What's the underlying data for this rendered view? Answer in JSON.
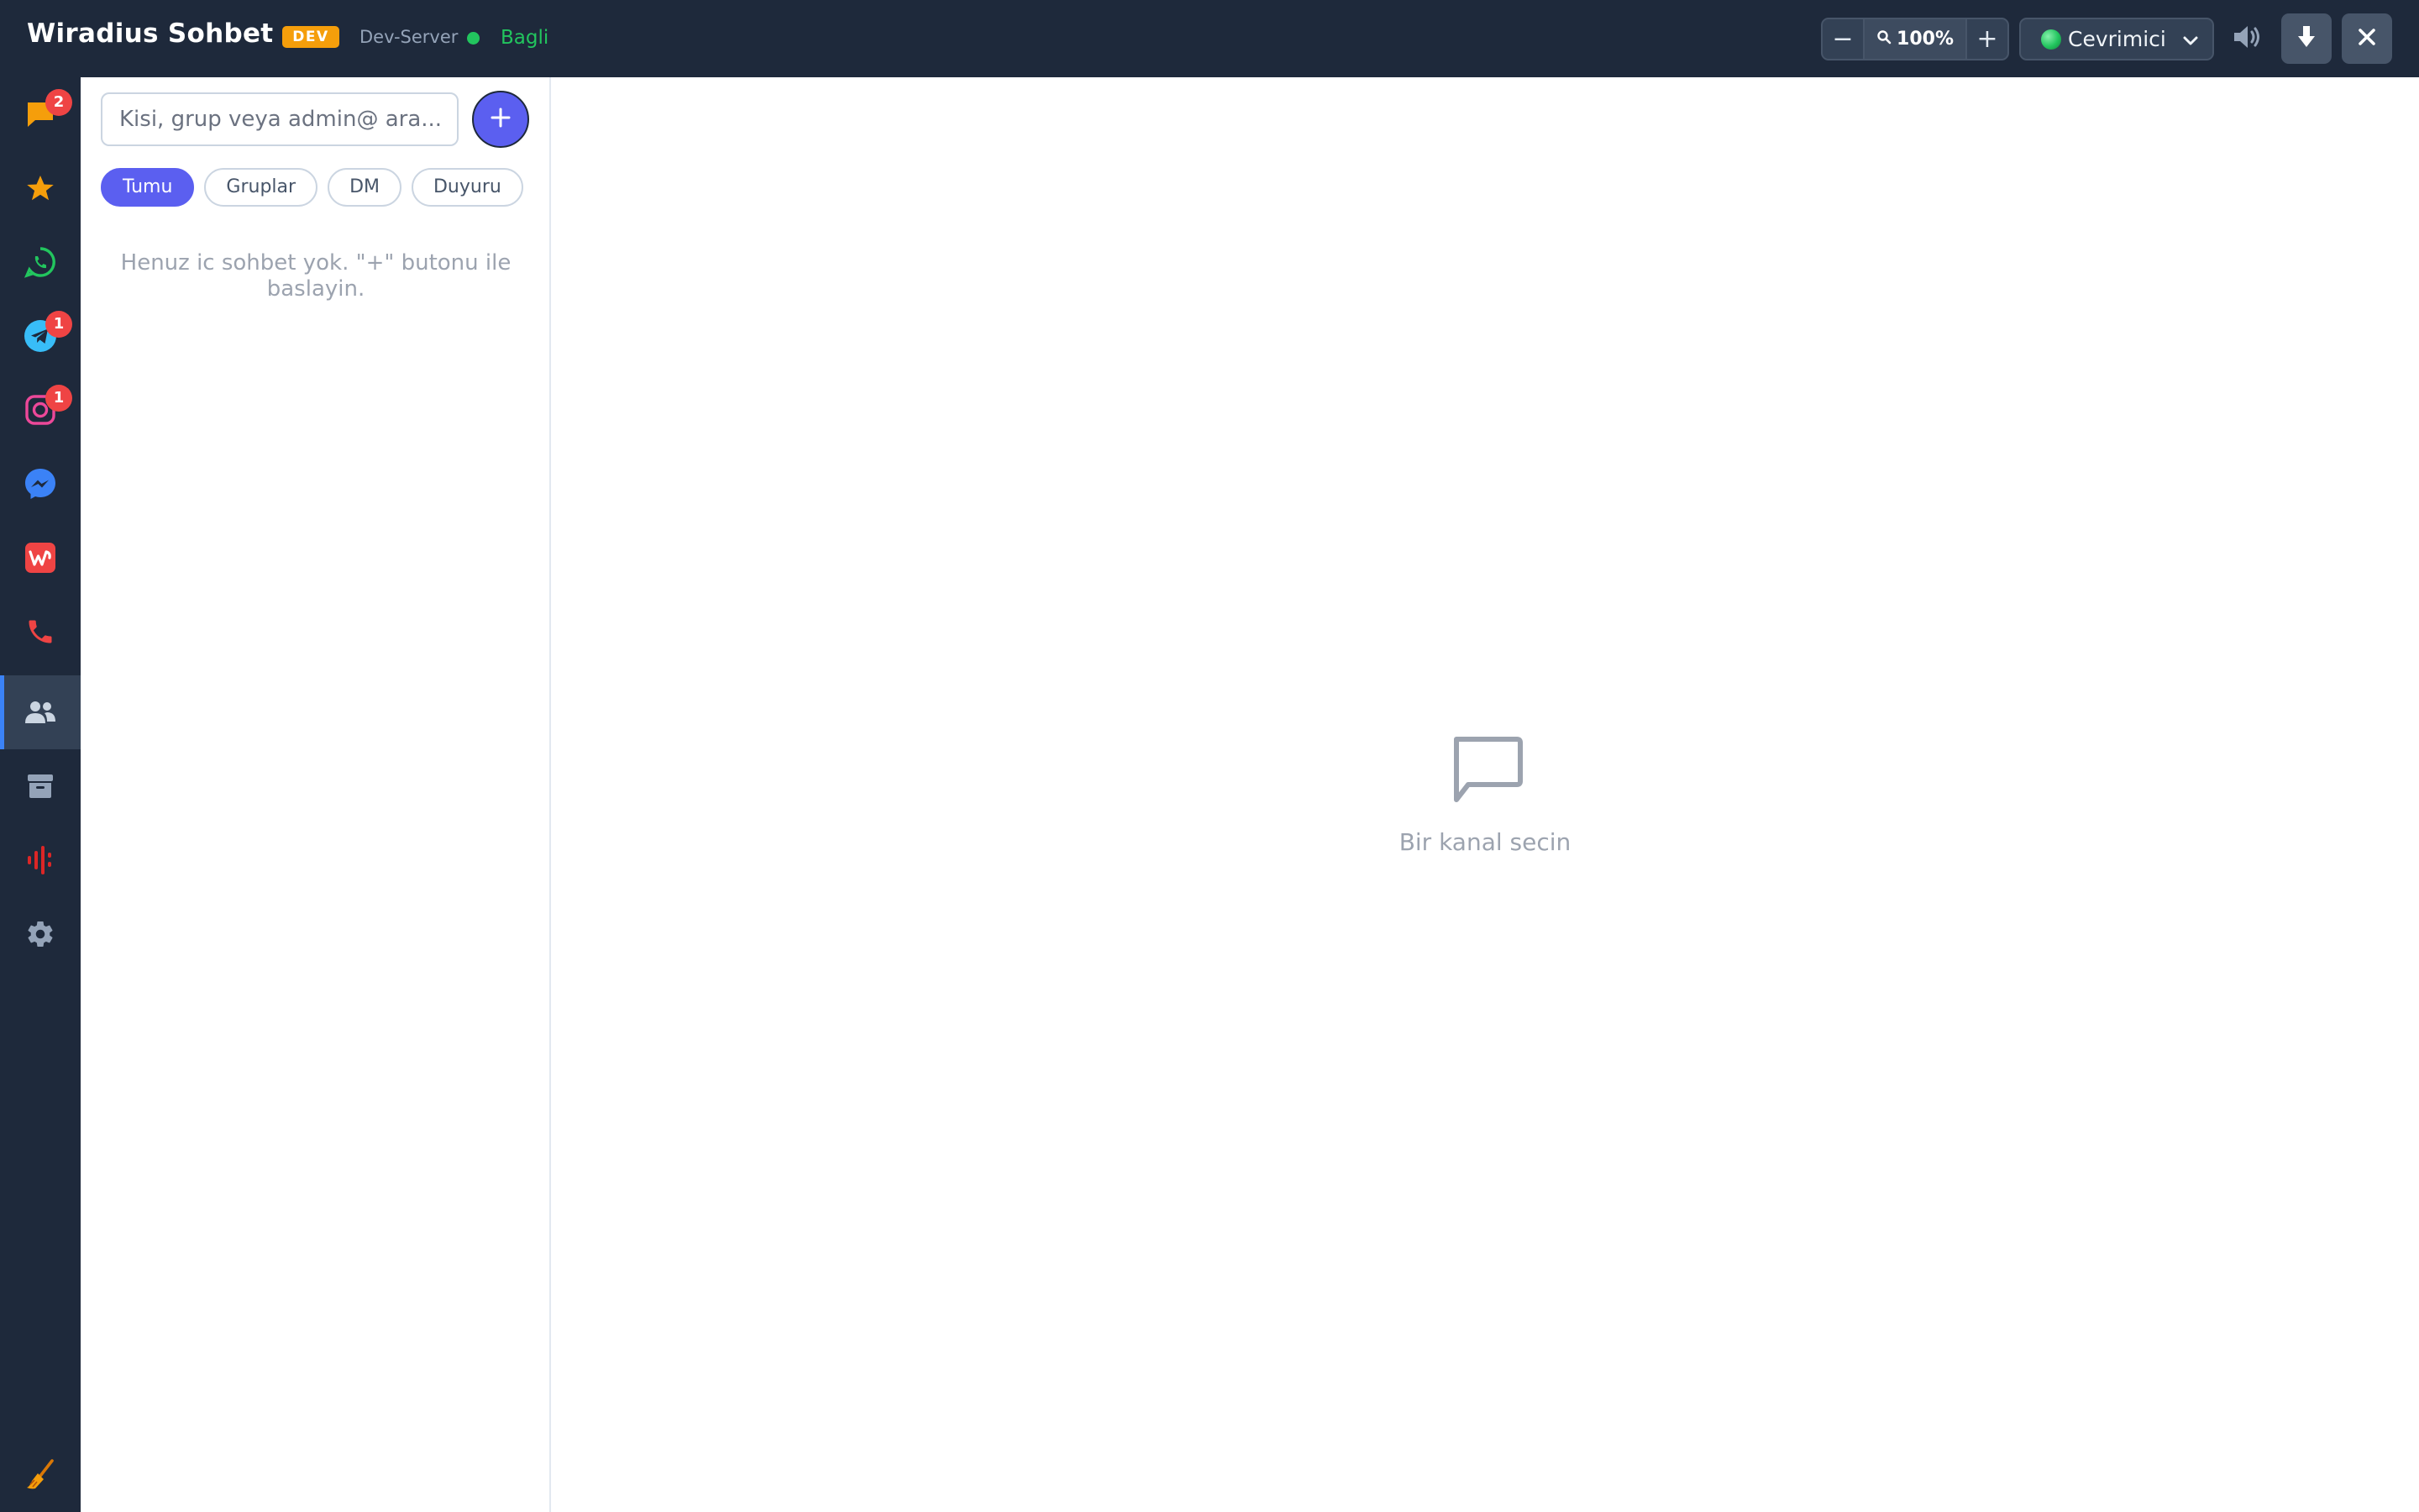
{
  "header": {
    "app_title": "Wiradius Sohbet",
    "env_badge": "DEV",
    "server_name": "Dev-Server",
    "connection_status": "Bagli",
    "zoom_level": "100%",
    "zoom_out_label": "−",
    "zoom_in_label": "+",
    "presence": "Cevrimici",
    "icons": [
      "magnifier-icon",
      "chevron-down-icon",
      "speaker-icon",
      "download-icon",
      "close-icon"
    ]
  },
  "sidebar": {
    "items": [
      {
        "name": "chat",
        "icon": "chat-bubble-icon",
        "badge": "2",
        "color": "#f59e0b"
      },
      {
        "name": "favorites",
        "icon": "star-icon",
        "badge": "",
        "color": "#f59e0b"
      },
      {
        "name": "whatsapp",
        "icon": "whatsapp-icon",
        "badge": "",
        "color": "#22c55e"
      },
      {
        "name": "telegram",
        "icon": "telegram-icon",
        "badge": "1",
        "color": "#38bdf8"
      },
      {
        "name": "instagram",
        "icon": "instagram-icon",
        "badge": "1",
        "color": "#ec4899"
      },
      {
        "name": "messenger",
        "icon": "messenger-icon",
        "badge": "",
        "color": "#3b82f6"
      },
      {
        "name": "brand-w",
        "icon": "w-logo-icon",
        "badge": "",
        "color": "#ef4444"
      },
      {
        "name": "calls",
        "icon": "phone-icon",
        "badge": "",
        "color": "#ef4444"
      },
      {
        "name": "contacts",
        "icon": "people-icon",
        "badge": "",
        "color": "#cbd5e1",
        "active": true
      },
      {
        "name": "archive",
        "icon": "archive-icon",
        "badge": "",
        "color": "#94a3b8"
      },
      {
        "name": "voice",
        "icon": "voice-wave-icon",
        "badge": "",
        "color": "#dc2626"
      },
      {
        "name": "settings",
        "icon": "gear-icon",
        "badge": "",
        "color": "#94a3b8"
      },
      {
        "name": "cleanup",
        "icon": "broom-icon",
        "badge": "",
        "color": "#f59e0b"
      }
    ]
  },
  "chat_list": {
    "search_placeholder": "Kisi, grup veya admin@ ara...",
    "new_chat_label": "+",
    "filters": [
      "Tumu",
      "Gruplar",
      "DM",
      "Duyuru"
    ],
    "active_filter": "Tumu",
    "empty_text": "Henuz ic sohbet yok. \"+\" butonu ile baslayin."
  },
  "main": {
    "empty_state_text": "Bir kanal secin"
  },
  "colors": {
    "topbar_bg": "#1e293b",
    "accent": "#5b5ff0",
    "online": "#22c55e",
    "badge": "#ef4444",
    "dev_badge": "#f59e0b"
  }
}
